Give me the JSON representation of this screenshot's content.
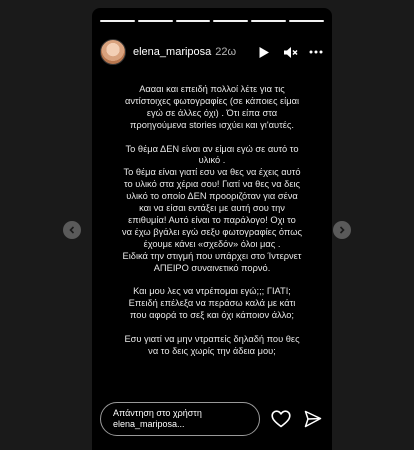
{
  "story": {
    "progress_segments": 6,
    "active_segment_index": 5,
    "header": {
      "username": "elena_mariposa",
      "timestamp": "22ω",
      "play_icon": "play-icon",
      "mute_icon": "mute-icon",
      "more_icon": "more-icon"
    },
    "text": {
      "p1": [
        "Ααααι και επειδή πολλοί λέτε για τις",
        "αντίστοιχες φωτογραφίες (σε κάποιες είμαι",
        "εγώ σε άλλες όχι) . Ότι είπα στα",
        "προηγούμενα stories ισχύει και γι'αυτές."
      ],
      "p2": [
        "Το θέμα ΔΕΝ είναι αν είμαι εγώ σε αυτό το",
        "υλικό ."
      ],
      "p3": [
        "Το θέμα είναι γιατί εσυ να θες να έχεις αυτό",
        "το υλικό στα χέρια σου! Γιατί να θες να δεις",
        "υλικό το οποίο ΔΕΝ προοριζόταν για σένα",
        "και να είσαι εντάξει με αυτή σου την",
        "επιθυμία! Αυτό είναι το παράλογο! Οχι το",
        "να έχω βγάλει εγώ σεξυ φωτογραφίες όπως",
        "έχουμε κάνει «σχεδόν» όλοι μας .",
        "Ειδικά την στιγμή που υπάρχει στο Ίντερνετ",
        "ΑΠΕΙΡΟ συναινετικό πορνό."
      ],
      "p4": [
        "Και μου λες να ντρέπομαι εγώ;;; ΓΙΑΤΙ;",
        "Επειδή επέλεξα να περάσω καλά με κάτι",
        "που αφορά το σεξ και όχι κάποιον άλλο;"
      ],
      "p5": [
        "Εσυ γιατί να μην ντραπείς δηλαδή που θες",
        "να το δεις χωρίς την άδεια μου;"
      ]
    },
    "footer": {
      "reply_line1": "Απάντηση στο χρήστη",
      "reply_line2": "elena_mariposa...",
      "like_icon": "heart-icon",
      "share_icon": "send-icon"
    }
  },
  "navigation": {
    "prev_icon": "chevron-left-icon",
    "next_icon": "chevron-right-icon"
  }
}
